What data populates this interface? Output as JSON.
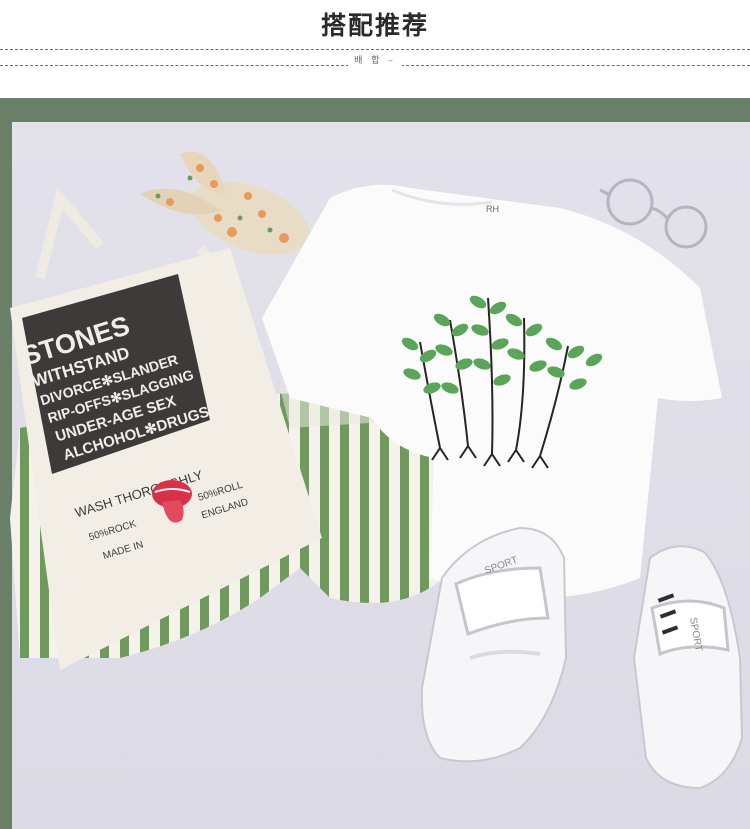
{
  "header": {
    "title": "搭配推荐",
    "subtitle": "배 합 –"
  },
  "bag": {
    "lines": [
      "STONES",
      "WITHSTAND",
      "DIVORCE✻SLANDER",
      "RIP-OFFS✻SLAGGING",
      "UNDER-AGE SEX",
      "ALCHOHOL✻DRUGS"
    ],
    "text_wash": "WASH THOROUGHLY",
    "text_roll": "50%ROLL",
    "text_rock": "50%ROCK",
    "text_england": "ENGLAND",
    "text_made": "MADE IN"
  },
  "tshirt_label": "RH",
  "shoe_text": "SPORT",
  "colors": {
    "background": "#e6e3eb",
    "stripe_green": "#6e9a5c",
    "leaf_green": "#5aa55a",
    "tongue_red": "#d8324a"
  }
}
